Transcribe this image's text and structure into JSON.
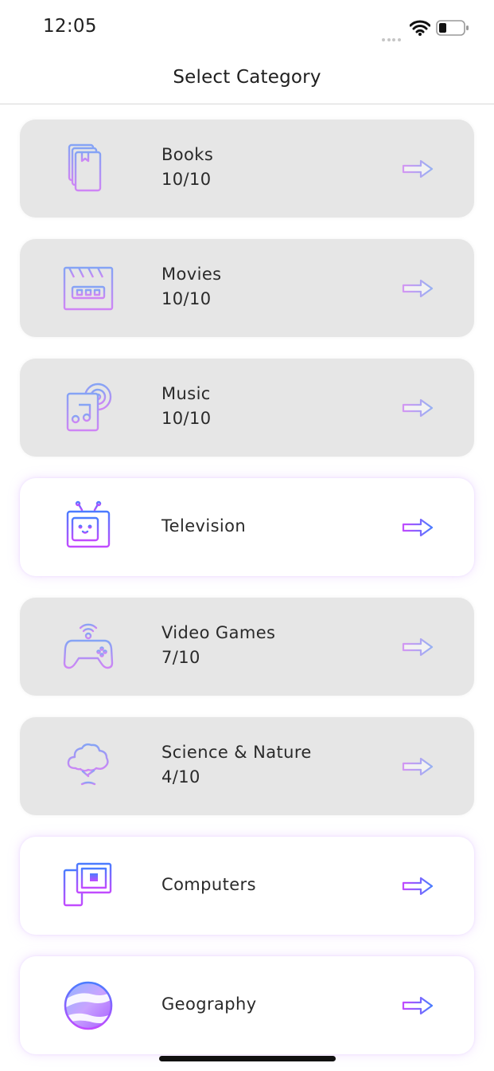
{
  "status_bar": {
    "time": "12:05"
  },
  "nav": {
    "title": "Select Category"
  },
  "colors": {
    "gradient_start": "#4a7cff",
    "gradient_end": "#c24bff",
    "completed_card": "#e6e6e6",
    "open_card": "#ffffff"
  },
  "categories": [
    {
      "name": "Books",
      "score": "10/10",
      "icon": "books-icon"
    },
    {
      "name": "Movies",
      "score": "10/10",
      "icon": "clapperboard-icon"
    },
    {
      "name": "Music",
      "score": "10/10",
      "icon": "music-album-icon"
    },
    {
      "name": "Television",
      "score": "",
      "icon": "television-icon"
    },
    {
      "name": "Video Games",
      "score": "7/10",
      "icon": "gamepad-icon"
    },
    {
      "name": "Science & Nature",
      "score": "4/10",
      "icon": "tree-icon"
    },
    {
      "name": "Computers",
      "score": "",
      "icon": "computer-icon"
    },
    {
      "name": "Geography",
      "score": "",
      "icon": "globe-icon"
    }
  ]
}
